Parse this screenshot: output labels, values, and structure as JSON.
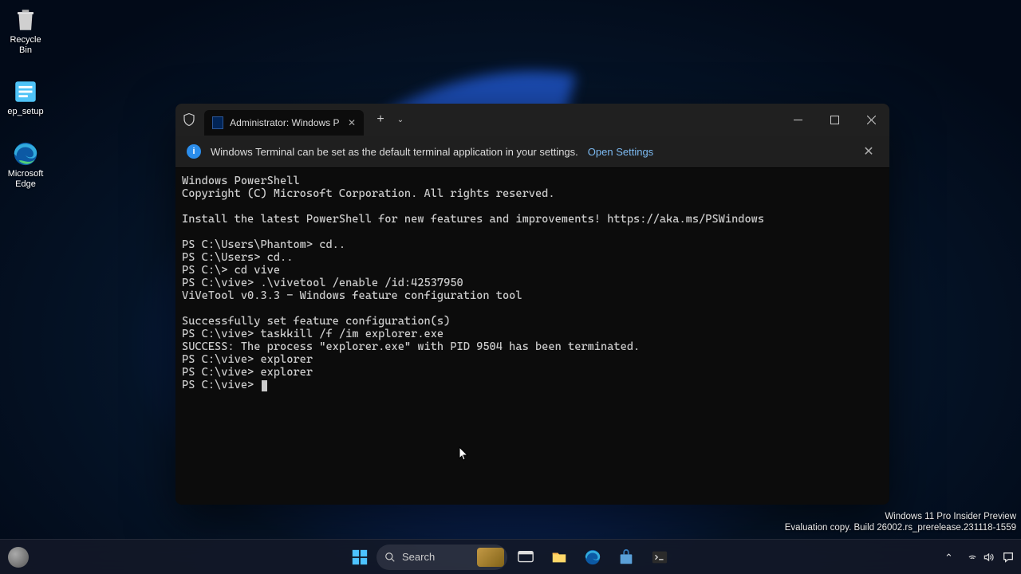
{
  "desktop": {
    "icons": [
      {
        "name": "recycle-bin",
        "label": "Recycle Bin"
      },
      {
        "name": "ep-setup",
        "label": "ep_setup"
      },
      {
        "name": "microsoft-edge",
        "label": "Microsoft Edge"
      }
    ]
  },
  "terminal": {
    "tab_title": "Administrator: Windows Powe",
    "banner": {
      "text": "Windows Terminal can be set as the default terminal application in your settings.",
      "link": "Open Settings"
    },
    "lines": [
      "Windows PowerShell",
      "Copyright (C) Microsoft Corporation. All rights reserved.",
      "",
      "Install the latest PowerShell for new features and improvements! https://aka.ms/PSWindows",
      "",
      "PS C:\\Users\\Phantom> cd..",
      "PS C:\\Users> cd..",
      "PS C:\\> cd vive",
      "PS C:\\vive> .\\vivetool /enable /id:42537950",
      "ViVeTool v0.3.3 - Windows feature configuration tool",
      "",
      "Successfully set feature configuration(s)",
      "PS C:\\vive> taskkill /f /im explorer.exe",
      "SUCCESS: The process \"explorer.exe\" with PID 9504 has been terminated.",
      "PS C:\\vive> explorer",
      "PS C:\\vive> explorer",
      "PS C:\\vive> "
    ]
  },
  "watermark": {
    "line1": "Windows 11 Pro Insider Preview",
    "line2": "Evaluation copy. Build 26002.rs_prerelease.231118-1559"
  },
  "taskbar": {
    "search_placeholder": "Search"
  }
}
